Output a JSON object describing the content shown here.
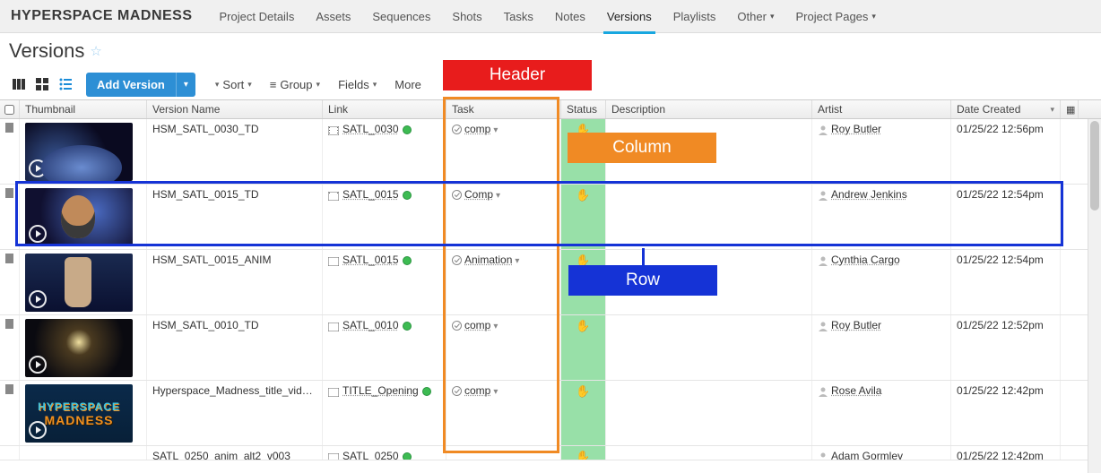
{
  "nav": {
    "project": "HYPERSPACE MADNESS",
    "items": [
      "Project Details",
      "Assets",
      "Sequences",
      "Shots",
      "Tasks",
      "Notes",
      "Versions",
      "Playlists",
      "Other",
      "Project Pages"
    ],
    "active_index": 6
  },
  "page": {
    "title": "Versions"
  },
  "toolbar": {
    "add_label": "Add Version",
    "sort": "Sort",
    "group": "Group",
    "fields": "Fields",
    "more": "More"
  },
  "columns": {
    "thumbnail": "Thumbnail",
    "version_name": "Version Name",
    "link": "Link",
    "task": "Task",
    "status": "Status",
    "description": "Description",
    "artist": "Artist",
    "date_created": "Date Created"
  },
  "annotations": {
    "header": "Header",
    "column": "Column",
    "row": "Row"
  },
  "rows": [
    {
      "name": "HSM_SATL_0030_TD",
      "link": "SATL_0030",
      "task": "comp",
      "artist": "Roy Butler",
      "date": "01/25/22 12:56pm"
    },
    {
      "name": "HSM_SATL_0015_TD",
      "link": "SATL_0015",
      "task": "Comp",
      "artist": "Andrew Jenkins",
      "date": "01/25/22 12:54pm"
    },
    {
      "name": "HSM_SATL_0015_ANIM",
      "link": "SATL_0015",
      "task": "Animation",
      "artist": "Cynthia Cargo",
      "date": "01/25/22 12:54pm"
    },
    {
      "name": "HSM_SATL_0010_TD",
      "link": "SATL_0010",
      "task": "comp",
      "artist": "Roy Butler",
      "date": "01/25/22 12:52pm"
    },
    {
      "name": "Hyperspace_Madness_title_vid…",
      "link": "TITLE_Opening",
      "task": "comp",
      "artist": "Rose Avila",
      "date": "01/25/22 12:42pm"
    },
    {
      "name": "SATL_0250_anim_alt2_v003",
      "link": "SATL_0250",
      "task": "",
      "artist": "Adam Gormley",
      "date": "01/25/22 12:42pm"
    }
  ],
  "thumb_logo": {
    "l1": "HYPERSPACE",
    "l2": "MADNESS"
  }
}
